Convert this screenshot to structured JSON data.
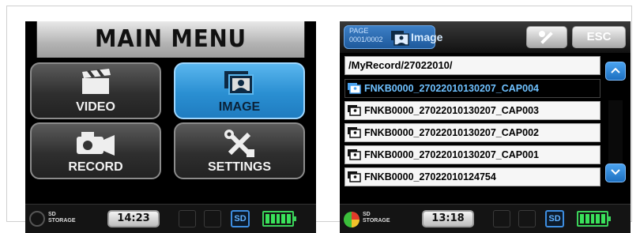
{
  "main_menu": {
    "title": "MAIN MENU",
    "tiles": [
      {
        "label": "VIDEO",
        "icon": "clapperboard-icon",
        "selected": false
      },
      {
        "label": "IMAGE",
        "icon": "photo-icon",
        "selected": true
      },
      {
        "label": "RECORD",
        "icon": "camcorder-icon",
        "selected": false
      },
      {
        "label": "SETTINGS",
        "icon": "tools-icon",
        "selected": false
      }
    ],
    "status": {
      "storage_line1": "SD",
      "storage_line2": "STORAGE",
      "time": "14:23",
      "sd": "SD",
      "battery": "full"
    }
  },
  "image_list": {
    "page_label": "PAGE",
    "page_num": "0001/0002",
    "mode": "Image",
    "esc": "ESC",
    "path": "/MyRecord/27022010/",
    "files": [
      {
        "name": "FNKB0000_27022010130207_CAP004",
        "selected": true
      },
      {
        "name": "FNKB0000_27022010130207_CAP003",
        "selected": false
      },
      {
        "name": "FNKB0000_27022010130207_CAP002",
        "selected": false
      },
      {
        "name": "FNKB0000_27022010130207_CAP001",
        "selected": false
      },
      {
        "name": "FNKB0000_27022010124754",
        "selected": false
      }
    ],
    "status": {
      "storage_line1": "SD",
      "storage_line2": "STORAGE",
      "time": "13:18",
      "sd": "SD",
      "battery": "full"
    }
  },
  "colors": {
    "accent": "#2a8fd2",
    "selected_text": "#6ec1ff",
    "battery": "#39e25a"
  }
}
